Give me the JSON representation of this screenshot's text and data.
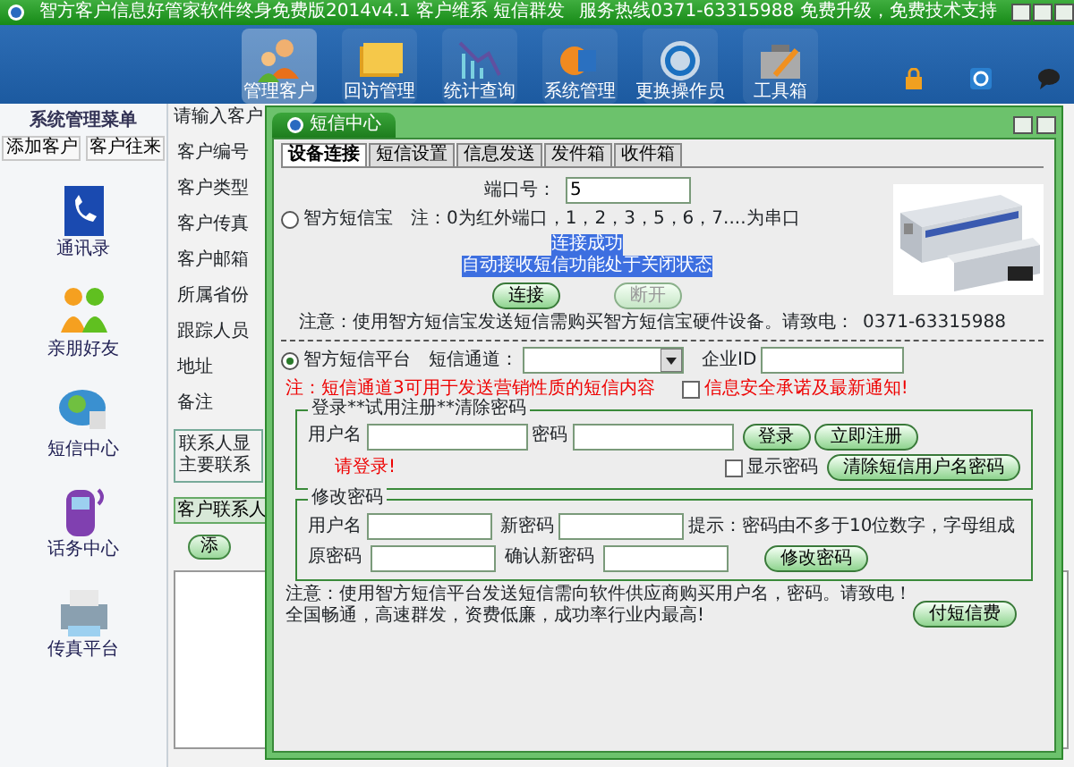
{
  "window": {
    "title": "智方客户信息好管家软件终身免费版2014v4.1 客户维系 短信群发",
    "hotline": "服务热线0371-63315988 免费升级，免费技术支持"
  },
  "toolbar": [
    {
      "label": "管理客户",
      "selected": true
    },
    {
      "label": "回访管理",
      "selected": false
    },
    {
      "label": "统计查询",
      "selected": false
    },
    {
      "label": "系统管理",
      "selected": false
    },
    {
      "label": "更换操作员",
      "selected": false
    },
    {
      "label": "工具箱",
      "selected": false
    }
  ],
  "sidebar": {
    "title": "系统管理菜单",
    "buttons": [
      "添加客户",
      "客户往来"
    ],
    "items": [
      "通讯录",
      "亲朋好友",
      "短信中心",
      "话务中心",
      "传真平台"
    ]
  },
  "customer_form": {
    "search_label": "请输入客户",
    "fields": [
      "客户编号",
      "客户类型",
      "客户传真",
      "客户邮箱",
      "所属省份",
      "跟踪人员",
      "地址",
      "备注"
    ],
    "contacts_group": [
      "联系人显",
      "主要联系"
    ],
    "tab": "客户联系人",
    "add_button": "添"
  },
  "sms_dialog": {
    "title": "短信中心",
    "tabs": [
      {
        "label": "设备连接",
        "selected": true
      },
      {
        "label": "短信设置",
        "selected": false
      },
      {
        "label": "信息发送",
        "selected": false
      },
      {
        "label": "发件箱",
        "selected": false
      },
      {
        "label": "收件箱",
        "selected": false
      }
    ],
    "port_label": "端口号：",
    "port_value": "5",
    "device_option": {
      "label": "智方短信宝",
      "selected": false
    },
    "port_note": "注：0为红外端口，1，2，3，5，6，7....为串口",
    "status_lines": [
      "连接成功",
      "自动接收短信功能处于关闭状态"
    ],
    "connect_button": {
      "label": "连接",
      "disabled": false
    },
    "disconnect_button": {
      "label": "断开",
      "disabled": true
    },
    "device_note": "注意：使用智方短信宝发送短信需购买智方短信宝硬件设备。请致电：",
    "device_phone": "0371-63315988",
    "platform_option": {
      "label": "智方短信平台",
      "selected": true
    },
    "channel_label": "短信通道：",
    "company_id_label": "企业ID",
    "channel_note": "注：短信通道3可用于发送营销性质的短信内容",
    "notice": {
      "label": "信息安全承诺及最新通知!",
      "checked": false
    },
    "login": {
      "legend": "登录**试用注册**清除密码",
      "username_label": "用户名",
      "password_label": "密码",
      "login_button": "登录",
      "register_button": "立即注册",
      "status": "请登录!",
      "show_password": {
        "label": "显示密码",
        "checked": false
      },
      "clear_button": "清除短信用户名密码"
    },
    "change_password": {
      "legend": "修改密码",
      "username_label": "用户名",
      "new_label": "新密码",
      "hint": "提示：密码由不多于10位数字，字母组成",
      "old_label": "原密码",
      "confirm_label": "确认新密码",
      "submit_button": "修改密码"
    },
    "footer_notes": [
      "注意：使用智方短信平台发送短信需向软件供应商购买用户名，密码。请致电！",
      "全国畅通，高速群发，资费低廉，成功率行业内最高!"
    ],
    "pay_button": "付短信费"
  }
}
